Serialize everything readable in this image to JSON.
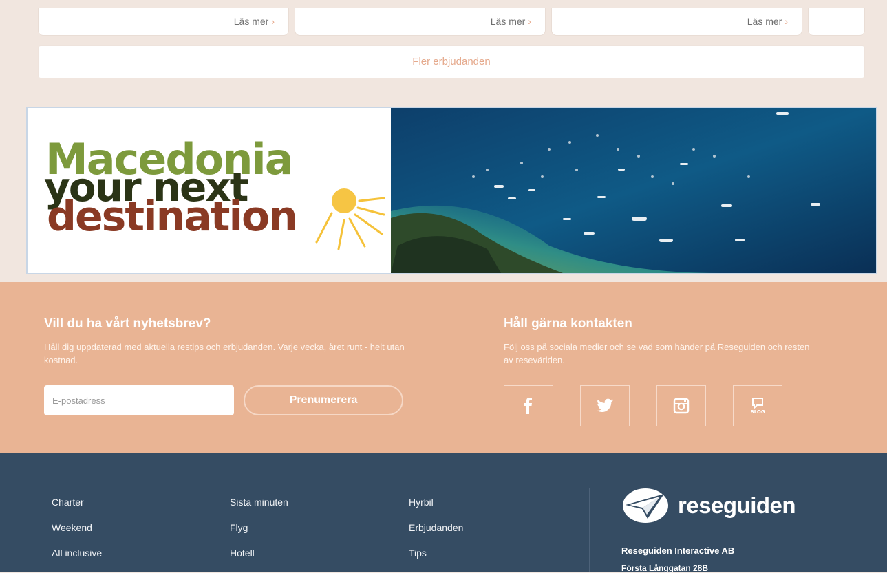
{
  "offers": {
    "cards": [
      {
        "more_label": "Läs mer",
        "chevron": "›"
      },
      {
        "more_label": "Läs mer",
        "chevron": "›"
      },
      {
        "more_label": "Läs mer",
        "chevron": "›"
      }
    ],
    "more_offers_label": "Fler erbjudanden"
  },
  "banner": {
    "line1": "Macedonia",
    "line2": "your next",
    "line3": "destination",
    "colors": {
      "line1": "#7d9a3c",
      "line2": "#2b3416",
      "line3": "#8a3a24",
      "sun": "#f5c23a"
    }
  },
  "newsletter": {
    "title": "Vill du ha vårt nyhetsbrev?",
    "text": "Håll dig uppdaterad med aktuella restips och erbjudanden. Varje vecka, året runt - helt utan kostnad.",
    "email_placeholder": "E-postadress",
    "subscribe_label": "Prenumerera"
  },
  "contact": {
    "title": "Håll gärna kontakten",
    "text": "Följ oss på sociala medier och se vad som händer på Reseguiden och resten av resevärlden.",
    "social": [
      {
        "icon": "facebook-icon"
      },
      {
        "icon": "twitter-icon"
      },
      {
        "icon": "instagram-icon"
      },
      {
        "icon": "blog-icon",
        "label": "BLOG"
      }
    ]
  },
  "footer": {
    "col1": [
      "Charter",
      "Weekend",
      "All inclusive"
    ],
    "col2": [
      "Sista minuten",
      "Flyg",
      "Hotell"
    ],
    "col3": [
      "Hyrbil",
      "Erbjudanden",
      "Tips"
    ],
    "brand_name": "reseguiden",
    "company": "Reseguiden Interactive AB",
    "street": "Första Långgatan 28B"
  },
  "colors": {
    "page_bg": "#f1e6df",
    "accent": "#e9b494",
    "footer_bg": "#354c63"
  }
}
